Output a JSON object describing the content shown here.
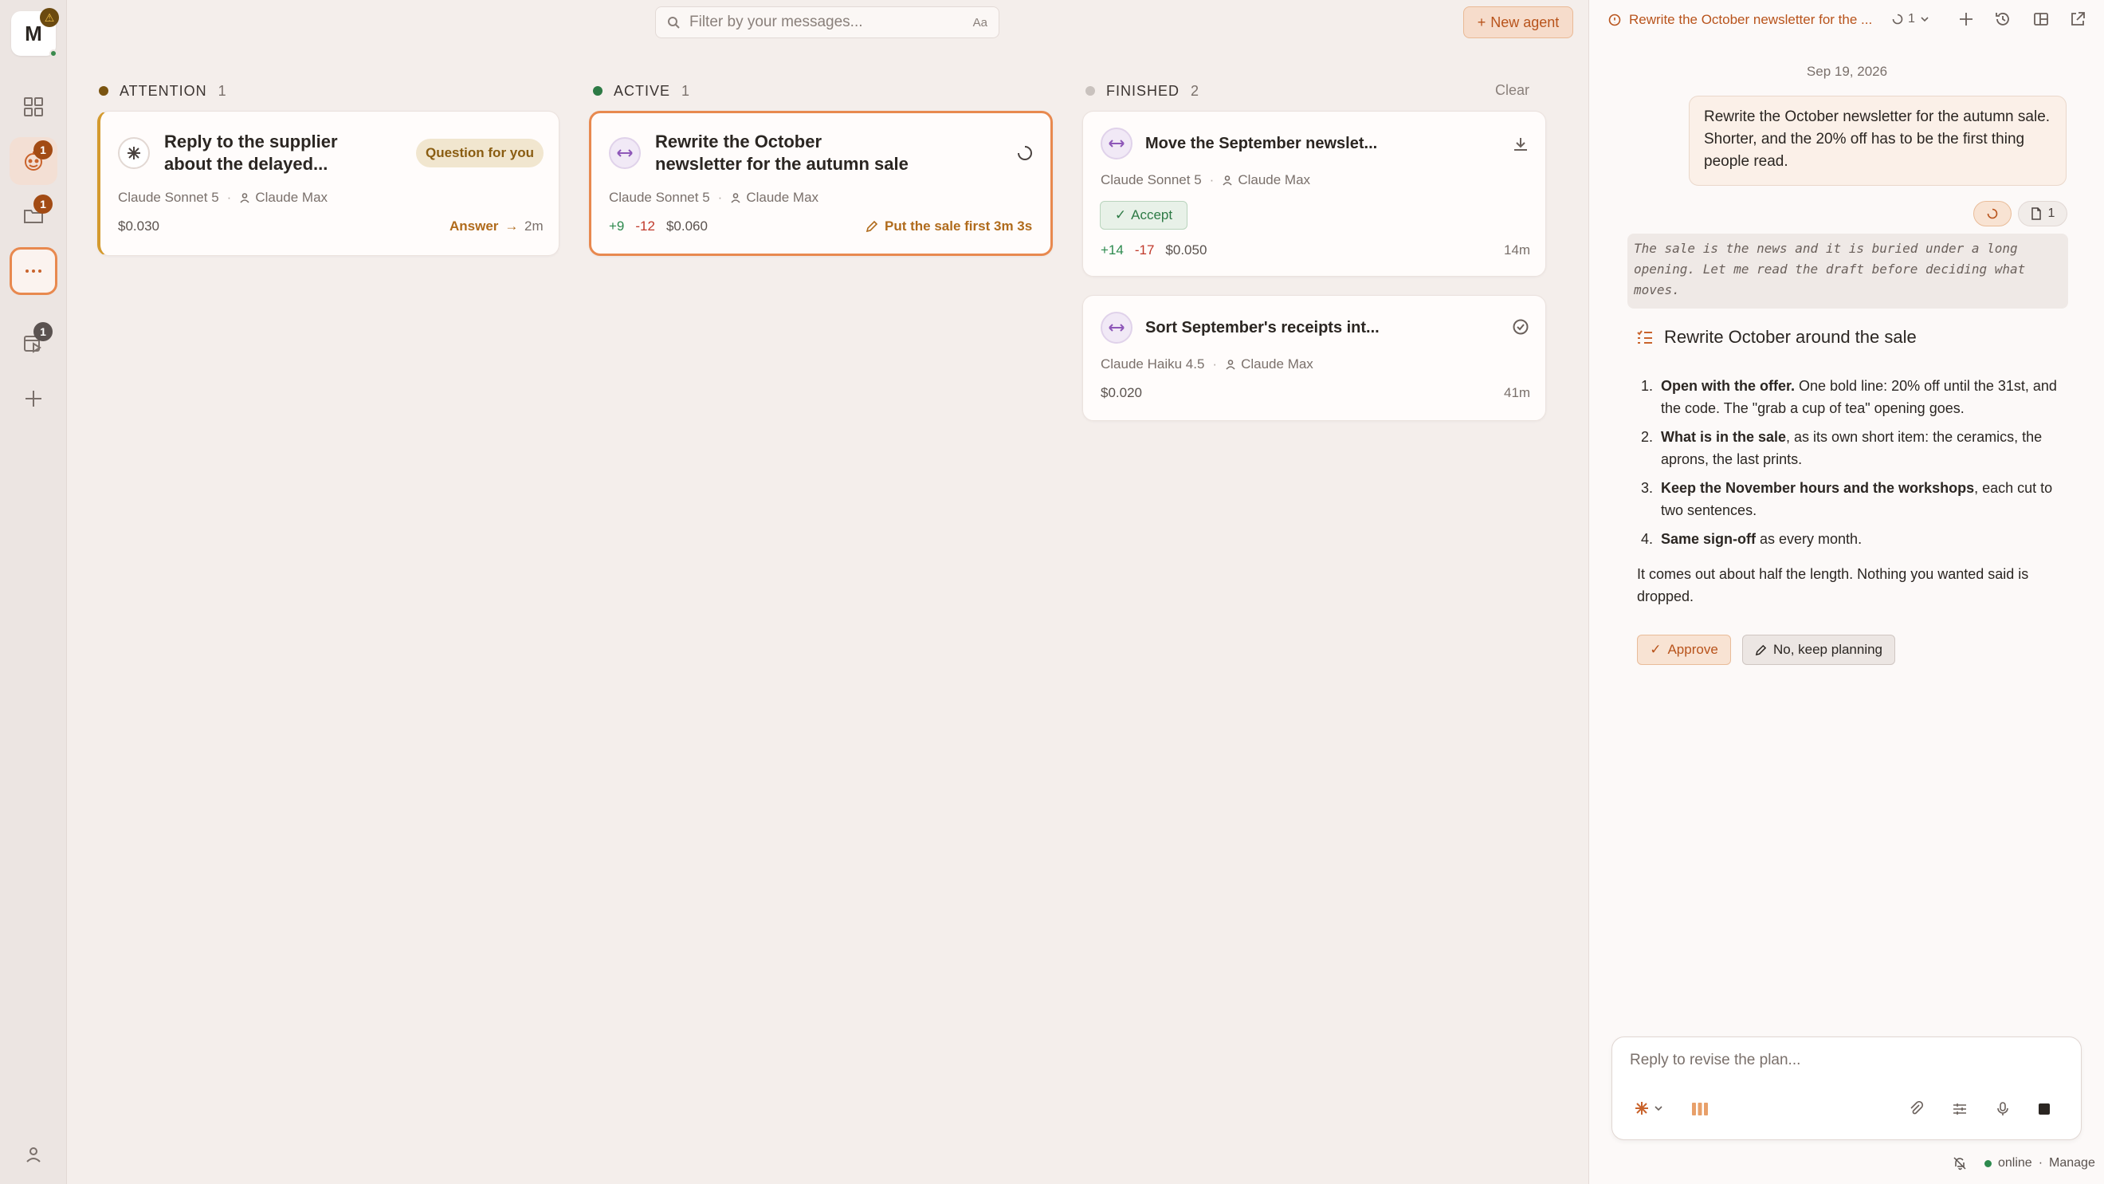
{
  "user": {
    "initial": "M"
  },
  "rail": {
    "badges": {
      "agents": "1",
      "files": "1",
      "queue": "1"
    }
  },
  "search": {
    "placeholder": "Filter by your messages...",
    "match_case": "Aa"
  },
  "new_agent": {
    "label": "New agent"
  },
  "columns": {
    "attention": {
      "label": "ATTENTION",
      "count": "1",
      "color": "#7a5410"
    },
    "active": {
      "label": "ACTIVE",
      "count": "1",
      "color": "#2d7a45"
    },
    "finished": {
      "label": "FINISHED",
      "count": "2",
      "color": "#c9c2be",
      "clear": "Clear"
    }
  },
  "cards": {
    "supplier": {
      "title_line1": "Reply to the supplier",
      "title_line2": "about the delayed...",
      "badge": "Question for you",
      "model": "Claude Sonnet 5",
      "account": "Claude Max",
      "cost": "$0.030",
      "action": "Answer",
      "time": "2m"
    },
    "newsletter": {
      "title_line1": "Rewrite the October",
      "title_line2": "newsletter for the autumn sale",
      "model": "Claude Sonnet 5",
      "account": "Claude Max",
      "added": "+9",
      "removed": "-12",
      "cost": "$0.060",
      "step": "Put the sale first",
      "time": "3m 3s"
    },
    "september": {
      "title": "Move the September newslet...",
      "model": "Claude Sonnet 5",
      "account": "Claude Max",
      "accept": "Accept",
      "added": "+14",
      "removed": "-17",
      "cost": "$0.050",
      "time": "14m"
    },
    "receipts": {
      "title": "Sort September's receipts int...",
      "model": "Claude Haiku 4.5",
      "account": "Claude Max",
      "cost": "$0.020",
      "time": "41m"
    }
  },
  "panel": {
    "title": "Rewrite the October newsletter for the ...",
    "run_count": "1",
    "date": "Sep 19, 2026",
    "user_message": "Rewrite the October newsletter for the autumn sale. Shorter, and the 20% off has to be the first thing people read.",
    "files_count": "1",
    "thinking": "The sale is the news and it is buried under a long opening. Let me read the draft before deciding what moves.",
    "plan_title": "Rewrite October around the sale",
    "plan": [
      {
        "n": "1.",
        "bold": "Open with the offer.",
        "rest": " One bold line: 20% off until the 31st, and the code. The \"grab a cup of tea\" opening goes."
      },
      {
        "n": "2.",
        "bold": "What is in the sale",
        "rest": ", as its own short item: the ceramics, the aprons, the last prints."
      },
      {
        "n": "3.",
        "bold": "Keep the November hours and the workshops",
        "rest": ", each cut to two sentences."
      },
      {
        "n": "4.",
        "bold": "Same sign-off",
        "rest": " as every month."
      }
    ],
    "plan_footer": "It comes out about half the length. Nothing you wanted said is dropped.",
    "approve": "Approve",
    "keep_planning": "No, keep planning",
    "composer_placeholder": "Reply to revise the plan...",
    "status": "online",
    "manage": "Manage"
  }
}
